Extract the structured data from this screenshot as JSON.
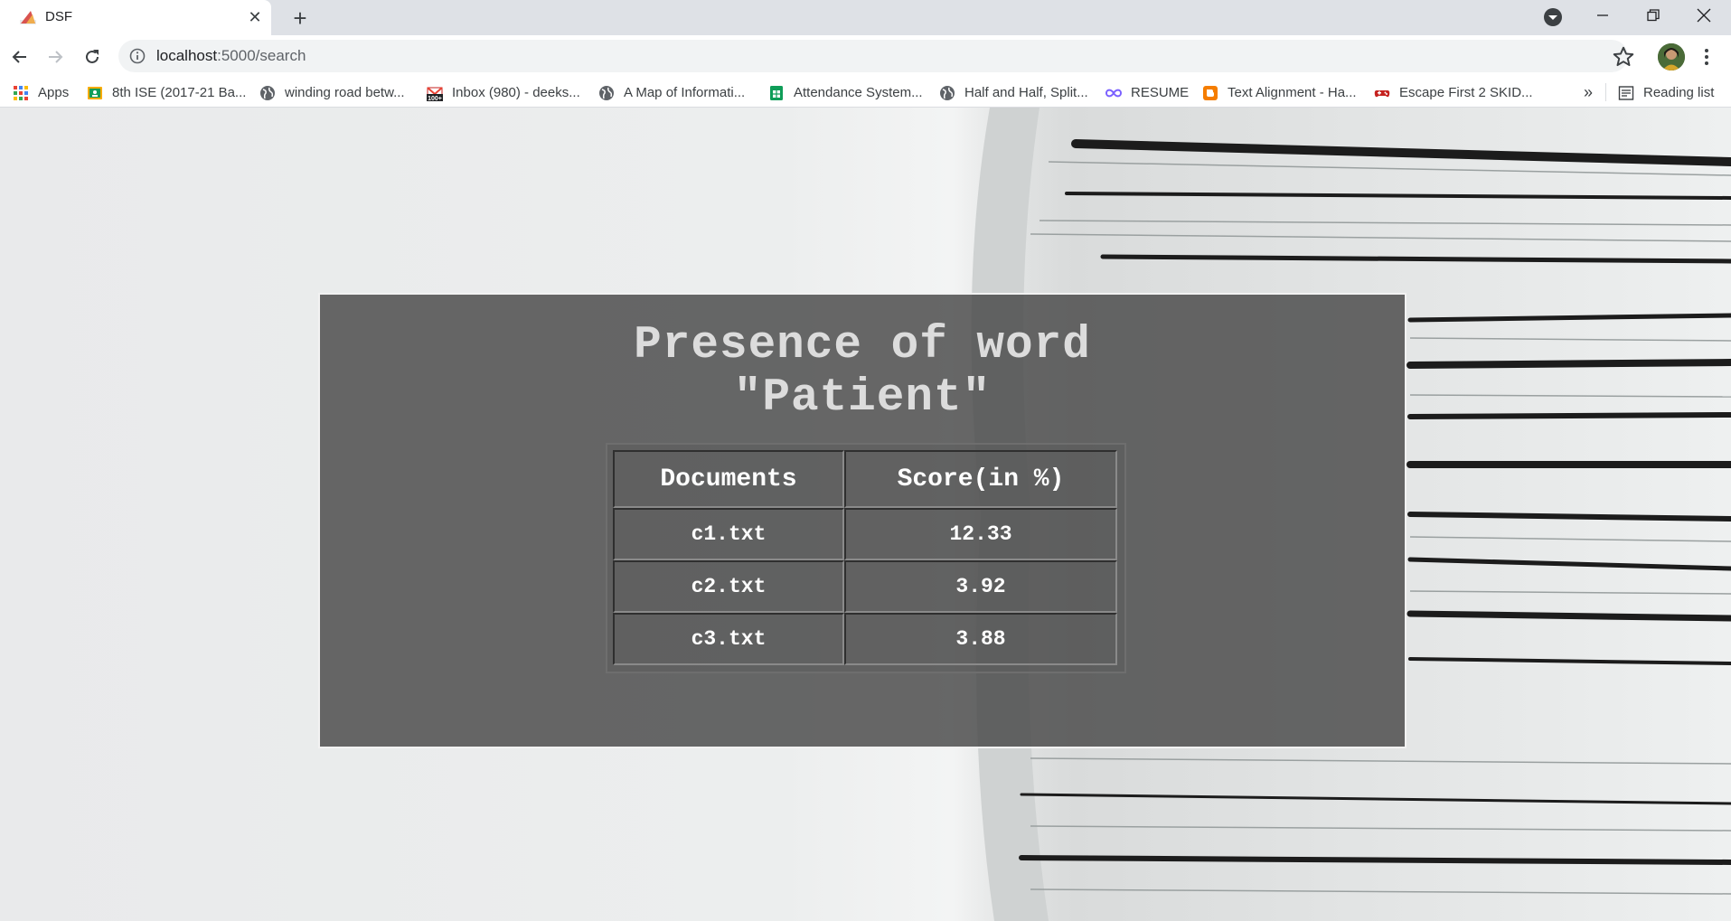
{
  "browser": {
    "tab": {
      "title": "DSF"
    },
    "url": {
      "host": "localhost",
      "path": ":5000/search"
    },
    "bookmarks": [
      {
        "label": "Apps",
        "icon": "apps-grid-icon"
      },
      {
        "label": "8th ISE (2017-21 Ba...",
        "icon": "classroom-icon"
      },
      {
        "label": "winding road betw...",
        "icon": "globe-icon"
      },
      {
        "label": "Inbox (980) - deeks...",
        "icon": "gmail-icon"
      },
      {
        "label": "A Map of Informati...",
        "icon": "globe-icon"
      },
      {
        "label": "Attendance System...",
        "icon": "sheets-icon"
      },
      {
        "label": "Half and Half, Split...",
        "icon": "globe-icon"
      },
      {
        "label": "RESUME",
        "icon": "infinity-icon"
      },
      {
        "label": "Text Alignment - Ha...",
        "icon": "blogger-icon"
      },
      {
        "label": "Escape First 2 SKID...",
        "icon": "gamepad-icon"
      }
    ],
    "more_bookmarks": "»",
    "reading_list": "Reading list"
  },
  "page": {
    "heading_line1": "Presence of word",
    "heading_line2": "\"Patient\"",
    "table": {
      "headers": [
        "Documents",
        "Score(in %)"
      ],
      "rows": [
        {
          "document": "c1.txt",
          "score": "12.33"
        },
        {
          "document": "c2.txt",
          "score": "3.92"
        },
        {
          "document": "c3.txt",
          "score": "3.88"
        }
      ]
    }
  },
  "colors": {
    "panel": "#4b4b4b",
    "heading": "#dcdcdc",
    "table_text": "#ffffff"
  }
}
